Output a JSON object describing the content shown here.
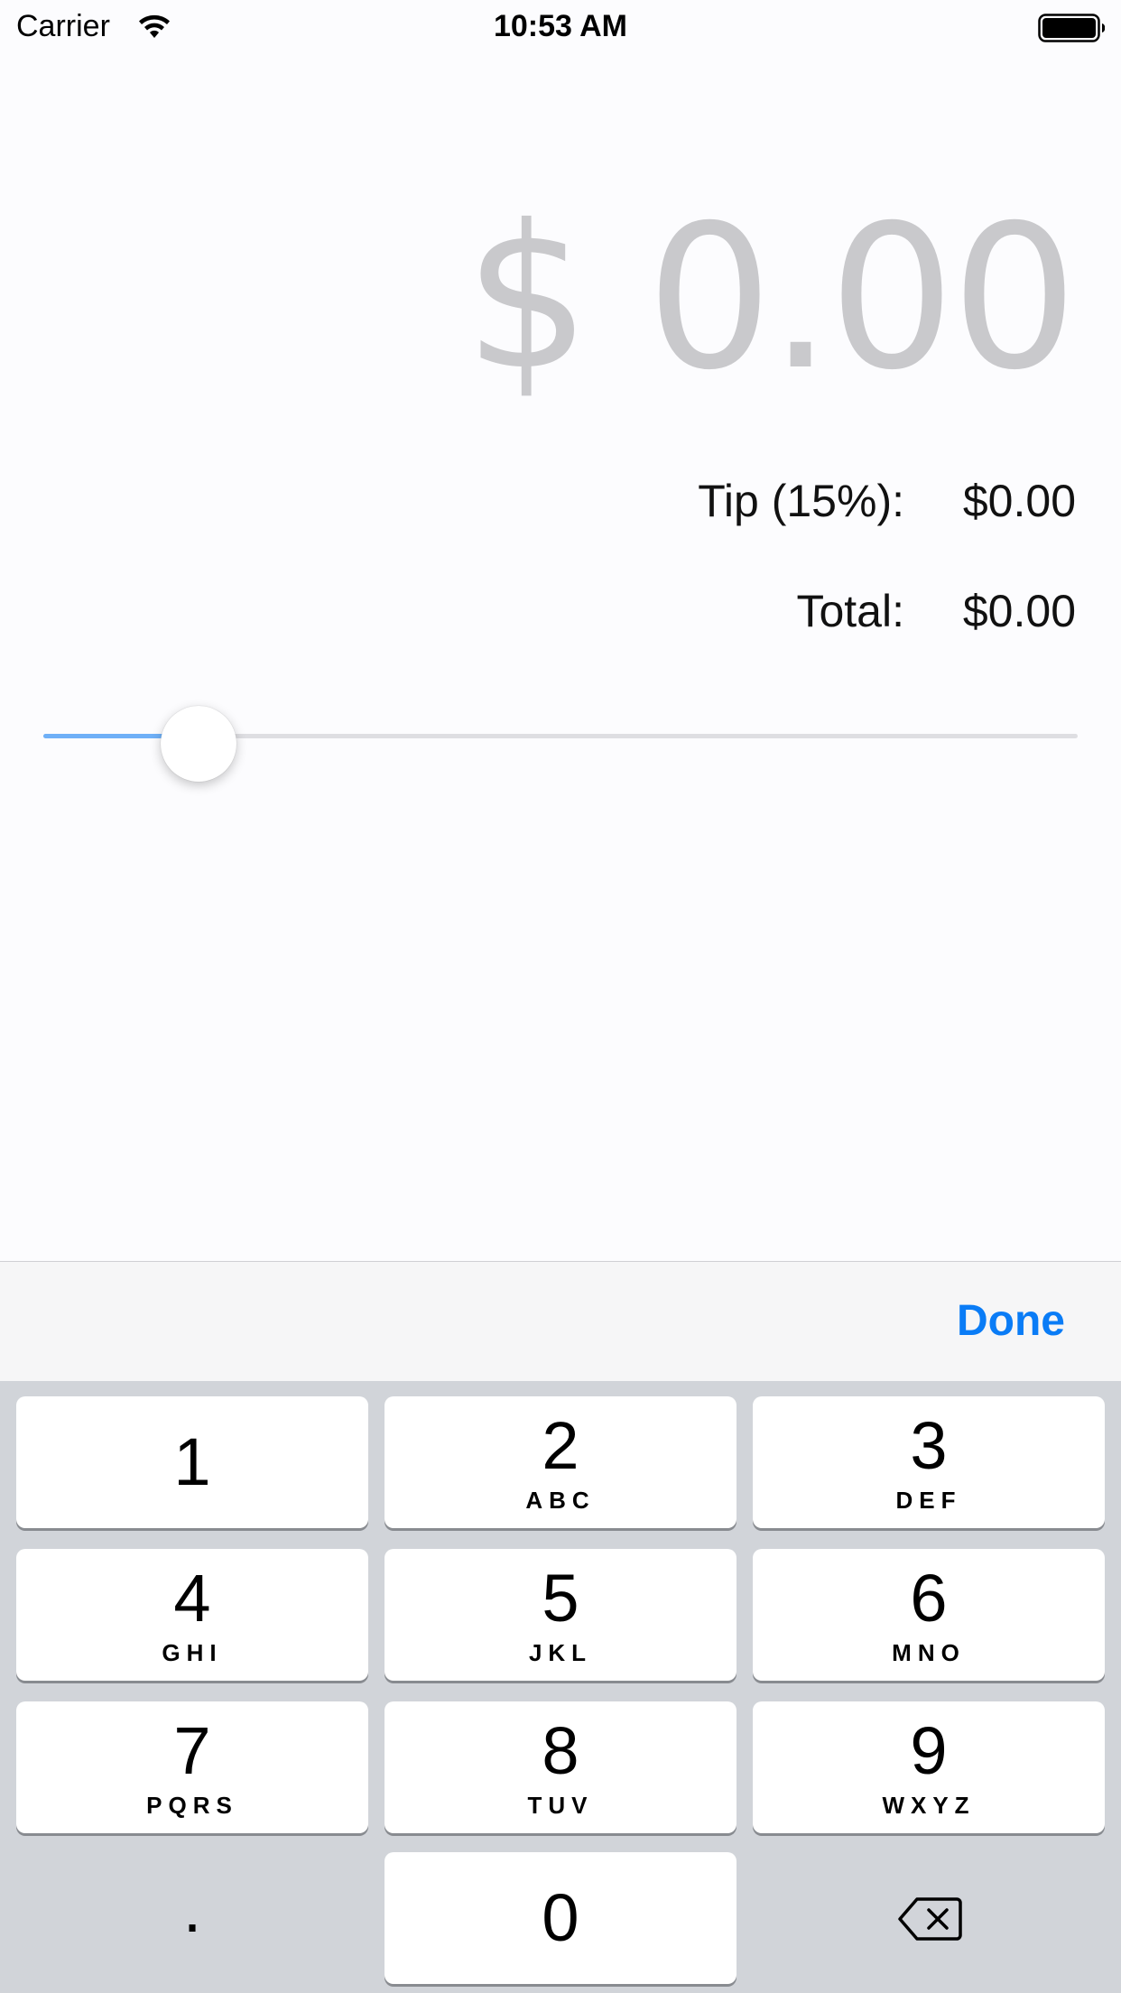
{
  "status_bar": {
    "carrier": "Carrier",
    "time": "10:53 AM"
  },
  "bill": {
    "amount": "$ 0.00",
    "color": "#c9c9cc"
  },
  "tip": {
    "label": "Tip (15%):",
    "value": "$0.00"
  },
  "total": {
    "label": "Total:",
    "value": "$0.00"
  },
  "slider": {
    "value_fraction": 0.15,
    "fill_color": "#6fb0f7",
    "track_color": "#dedee2"
  },
  "toolbar": {
    "done_label": "Done",
    "accent": "#0a7cf6"
  },
  "keypad": {
    "keys": [
      {
        "digit": "1",
        "letters": ""
      },
      {
        "digit": "2",
        "letters": "ABC"
      },
      {
        "digit": "3",
        "letters": "DEF"
      },
      {
        "digit": "4",
        "letters": "GHI"
      },
      {
        "digit": "5",
        "letters": "JKL"
      },
      {
        "digit": "6",
        "letters": "MNO"
      },
      {
        "digit": "7",
        "letters": "PQRS"
      },
      {
        "digit": "8",
        "letters": "TUV"
      },
      {
        "digit": "9",
        "letters": "WXYZ"
      }
    ],
    "decimal": ".",
    "zero": "0",
    "backspace_icon": "backspace-icon",
    "background": "#d1d4d9"
  }
}
